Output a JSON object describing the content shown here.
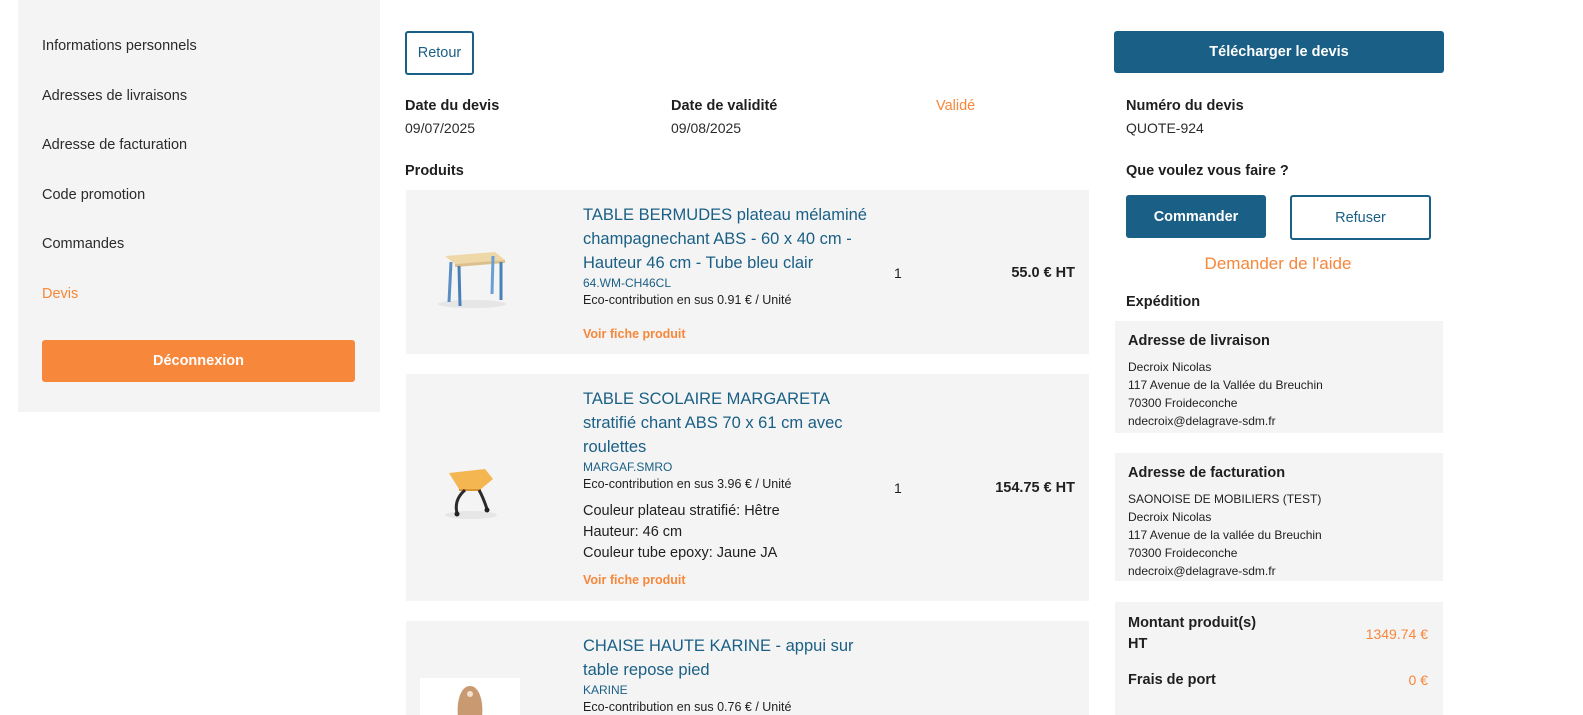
{
  "sidebar": {
    "items": [
      {
        "label": "Informations personnels"
      },
      {
        "label": "Adresses de livraisons"
      },
      {
        "label": "Adresse de facturation"
      },
      {
        "label": "Code promotion"
      },
      {
        "label": "Commandes"
      },
      {
        "label": "Devis"
      }
    ],
    "active_item": "Devis",
    "logout_label": "Déconnexion"
  },
  "header": {
    "back_label": "Retour",
    "download_label": "Télécharger le devis"
  },
  "quote": {
    "date_label": "Date du devis",
    "date_value": "09/07/2025",
    "validity_label": "Date de validité",
    "validity_value": "09/08/2025",
    "status": "Validé",
    "number_label": "Numéro du devis",
    "number_value": "QUOTE-924"
  },
  "products_title": "Produits",
  "products": [
    {
      "title": "TABLE BERMUDES plateau mélaminé champagnechant ABS - 60 x 40 cm - Hauteur 46 cm - Tube bleu clair",
      "ref": "64.WM-CH46CL",
      "eco": "Eco-contribution en sus 0.91 € / Unité",
      "options": [],
      "link": "Voir fiche produit",
      "qty": "1",
      "price": "55.0 € HT"
    },
    {
      "title": "TABLE SCOLAIRE MARGARETA stratifié chant ABS 70 x 61 cm avec roulettes",
      "ref": "MARGAF.SMRO",
      "eco": "Eco-contribution en sus 3.96 € / Unité",
      "options": [
        "Couleur plateau stratifié: Hêtre",
        "Hauteur: 46 cm",
        "Couleur tube epoxy: Jaune JA"
      ],
      "link": "Voir fiche produit",
      "qty": "1",
      "price": "154.75 € HT"
    },
    {
      "title": "CHAISE HAUTE KARINE - appui sur table repose pied",
      "ref": "KARINE",
      "eco": "Eco-contribution en sus 0.76 € / Unité"
    }
  ],
  "actions": {
    "question": "Que voulez vous faire ?",
    "order_label": "Commander",
    "refuse_label": "Refuser",
    "help_label": "Demander de l'aide"
  },
  "shipping": {
    "title": "Expédition",
    "delivery": {
      "title": "Adresse de livraison",
      "lines": [
        "Decroix Nicolas",
        "117 Avenue de la Vallée du Breuchin",
        "70300 Froideconche",
        "ndecroix@delagrave-sdm.fr"
      ]
    },
    "billing": {
      "title": "Adresse de facturation",
      "lines": [
        "SAONOISE DE MOBILIERS (TEST)",
        "Decroix Nicolas",
        "117 Avenue de la vallée du Breuchin",
        "70300 Froideconche",
        "ndecroix@delagrave-sdm.fr"
      ]
    }
  },
  "summary": {
    "products_label": "Montant produit(s) HT",
    "products_value": "1349.74 €",
    "shipping_label": "Frais de port",
    "shipping_value": "0 €"
  },
  "colors": {
    "primary": "#1a5f85",
    "accent": "#f7873a",
    "panel": "#f4f4f4"
  }
}
